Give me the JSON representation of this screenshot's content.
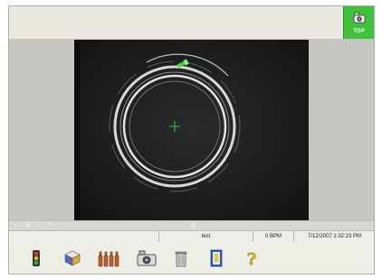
{
  "top_button": {
    "label": "TOP",
    "icon": "camera-icon"
  },
  "status_bar": {
    "camera_name": "test",
    "rate": "0 BPM",
    "datetime": "7/12/2007 1:32:23 PM"
  },
  "toolbar": [
    {
      "icon": "traffic-light-icon"
    },
    {
      "icon": "color-cube-icon"
    },
    {
      "icon": "bottles-icon"
    },
    {
      "icon": "camera-icon"
    },
    {
      "icon": "trash-can-icon"
    },
    {
      "icon": "exit-door-icon"
    },
    {
      "icon": "help-icon"
    }
  ],
  "colors": {
    "top_button": "#3fc23b",
    "crosshair": "#2fcf3a",
    "marker": "#39d43a"
  }
}
